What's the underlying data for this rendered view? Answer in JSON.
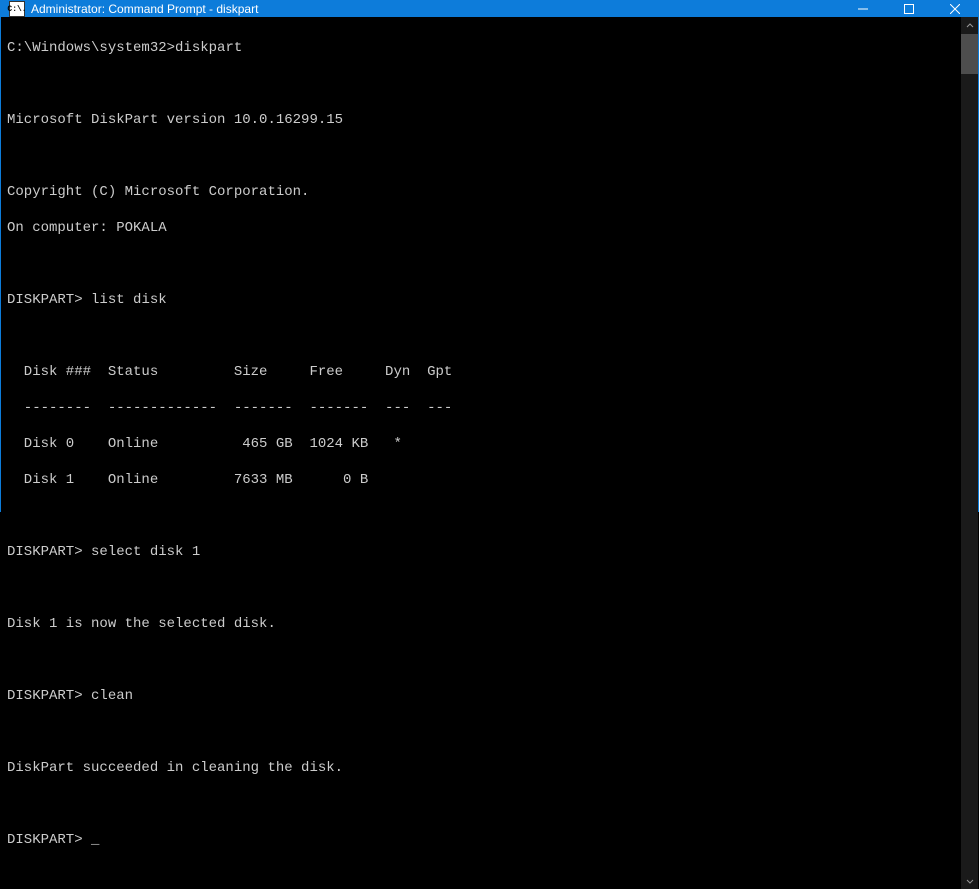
{
  "titlebar": {
    "icon_text": "C:\\.",
    "title": "Administrator: Command Prompt - diskpart"
  },
  "terminal": {
    "prompt_initial": "C:\\Windows\\system32>",
    "cmd_initial": "diskpart",
    "blank": "",
    "version_line": "Microsoft DiskPart version 10.0.16299.15",
    "copyright_line": "Copyright (C) Microsoft Corporation.",
    "computer_line": "On computer: POKALA",
    "prompt_dp": "DISKPART>",
    "cmd_list": "list disk",
    "table_header": "  Disk ###  Status         Size     Free     Dyn  Gpt",
    "table_divider": "  --------  -------------  -------  -------  ---  ---",
    "disk_row_0": "  Disk 0    Online          465 GB  1024 KB   *",
    "disk_row_1": "  Disk 1    Online         7633 MB      0 B",
    "cmd_select": "select disk 1",
    "msg_selected": "Disk 1 is now the selected disk.",
    "cmd_clean": "clean",
    "msg_cleaned": "DiskPart succeeded in cleaning the disk.",
    "cursor": "_"
  },
  "chart_data": {
    "type": "table",
    "title": "list disk",
    "columns": [
      "Disk ###",
      "Status",
      "Size",
      "Free",
      "Dyn",
      "Gpt"
    ],
    "rows": [
      {
        "Disk ###": "Disk 0",
        "Status": "Online",
        "Size": "465 GB",
        "Free": "1024 KB",
        "Dyn": "*",
        "Gpt": ""
      },
      {
        "Disk ###": "Disk 1",
        "Status": "Online",
        "Size": "7633 MB",
        "Free": "0 B",
        "Dyn": "",
        "Gpt": ""
      }
    ]
  }
}
